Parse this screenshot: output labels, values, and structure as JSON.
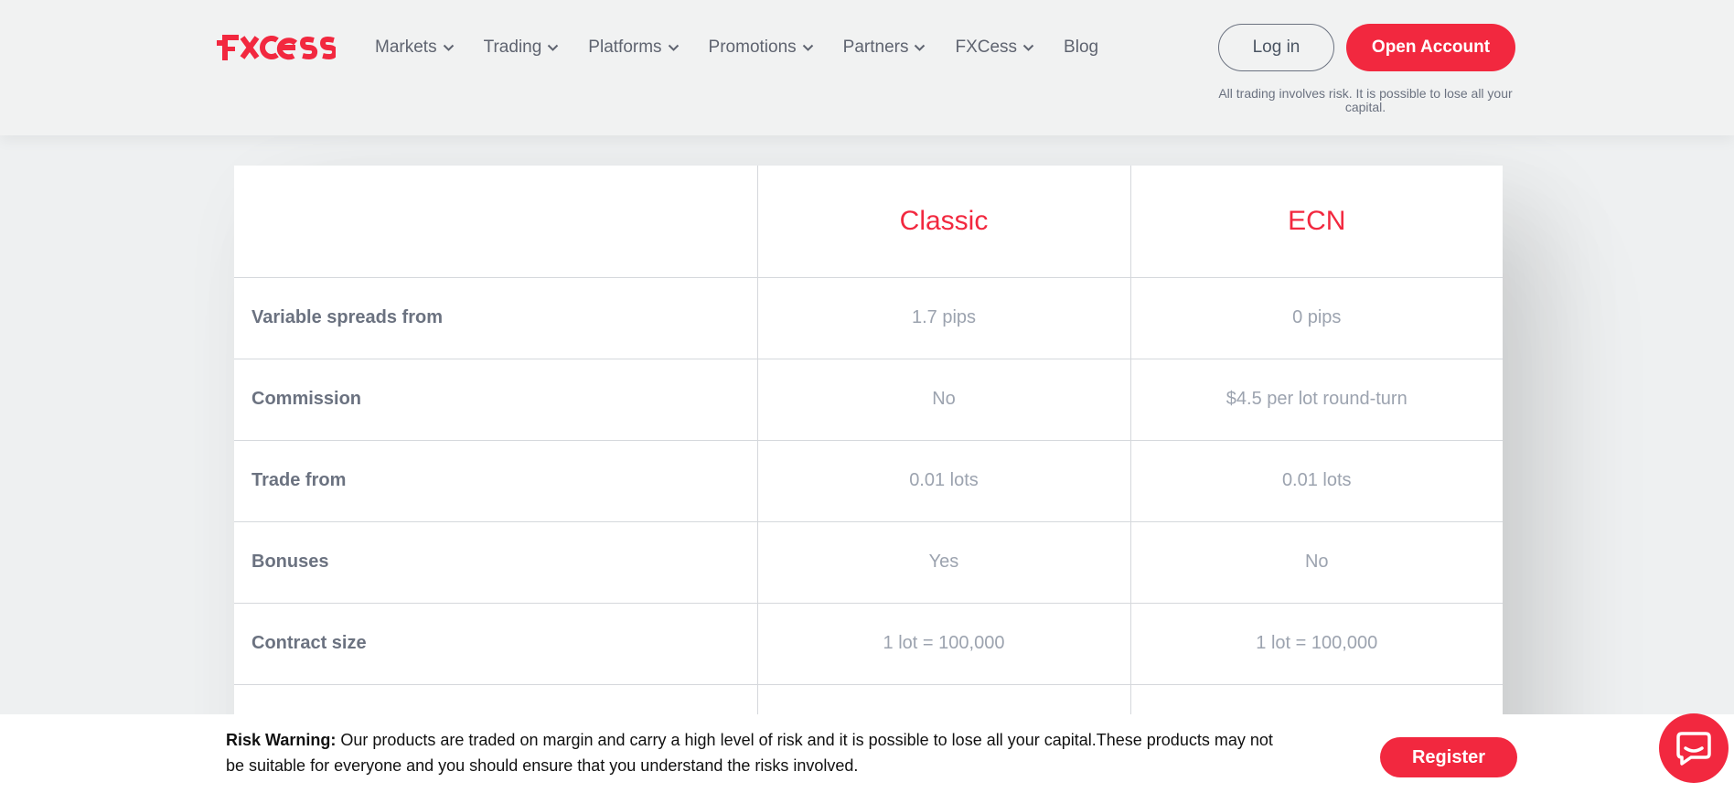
{
  "header": {
    "logo_text": "FXCESS",
    "nav": [
      {
        "label": "Markets",
        "has_dropdown": true
      },
      {
        "label": "Trading",
        "has_dropdown": true
      },
      {
        "label": "Platforms",
        "has_dropdown": true
      },
      {
        "label": "Promotions",
        "has_dropdown": true
      },
      {
        "label": "Partners",
        "has_dropdown": true
      },
      {
        "label": "FXCess",
        "has_dropdown": true
      },
      {
        "label": "Blog",
        "has_dropdown": false
      }
    ],
    "login_label": "Log in",
    "open_account_label": "Open Account",
    "risk_note": "All trading involves risk. It is possible to lose all your capital."
  },
  "comparison": {
    "columns": [
      "",
      "Classic",
      "ECN"
    ],
    "rows": [
      {
        "label": "Variable spreads from",
        "classic": "1.7 pips",
        "ecn": "0 pips"
      },
      {
        "label": "Commission",
        "classic": "No",
        "ecn": "$4.5 per lot round-turn"
      },
      {
        "label": "Trade from",
        "classic": "0.01 lots",
        "ecn": "0.01 lots"
      },
      {
        "label": "Bonuses",
        "classic": "Yes",
        "ecn": "No"
      },
      {
        "label": "Contract size",
        "classic": "1 lot = 100,000",
        "ecn": "1 lot = 100,000"
      },
      {
        "label": "",
        "classic": "",
        "ecn": ""
      }
    ]
  },
  "risk_bar": {
    "title": "Risk Warning:",
    "text": " Our products are traded on margin and carry a high level of risk and it is possible to lose all your capital.These products may not be suitable for everyone and you should ensure that you understand the risks involved.",
    "register_label": "Register"
  },
  "colors": {
    "accent": "#f2283f",
    "header_bg": "#f1f2f2",
    "page_bg": "#eef0f1"
  },
  "icons": {
    "nav_dropdown": "chevron-down-icon",
    "chat": "chat-bubble-icon"
  }
}
